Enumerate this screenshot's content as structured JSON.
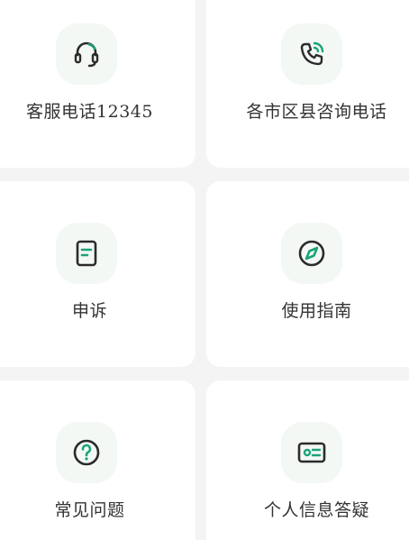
{
  "colors": {
    "background": "#f4f4f4",
    "card": "#ffffff",
    "icon_bg": "#f3f8f5",
    "accent": "#1aa37a",
    "icon_stroke": "#2b2b2b",
    "text": "#333333"
  },
  "cards": [
    {
      "label": "客服电话",
      "label_number": "12345",
      "icon": "headset-icon"
    },
    {
      "label": "各市区县咨询电话",
      "icon": "phone-call-icon"
    },
    {
      "label": "申诉",
      "icon": "document-icon"
    },
    {
      "label": "使用指南",
      "icon": "compass-icon"
    },
    {
      "label": "常见问题",
      "icon": "question-circle-icon"
    },
    {
      "label": "个人信息答疑",
      "icon": "id-card-icon"
    }
  ]
}
